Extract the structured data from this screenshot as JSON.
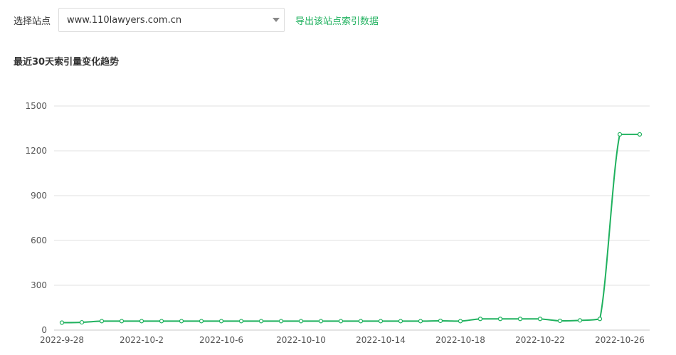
{
  "toolbar": {
    "site_label": "选择站点",
    "site_value": "www.110lawyers.com.cn",
    "export_label": "导出该站点索引数据"
  },
  "section_title": "最近30天索引量变化趋势",
  "colors": {
    "accent": "#1fb15e",
    "line": "#1fb15e",
    "grid": "#e0e0e0"
  },
  "icons": {
    "select_caret": "chevron-down-icon"
  },
  "chart_data": {
    "type": "line",
    "title": "",
    "xlabel": "",
    "ylabel": "",
    "ylim": [
      0,
      1500
    ],
    "y_ticks": [
      0,
      300,
      600,
      900,
      1200,
      1500
    ],
    "x_tick_labels": [
      "2022-9-28",
      "2022-10-2",
      "2022-10-6",
      "2022-10-10",
      "2022-10-14",
      "2022-10-18",
      "2022-10-22",
      "2022-10-26"
    ],
    "grid": true,
    "x": [
      "2022-9-28",
      "2022-9-29",
      "2022-9-30",
      "2022-10-1",
      "2022-10-2",
      "2022-10-3",
      "2022-10-4",
      "2022-10-5",
      "2022-10-6",
      "2022-10-7",
      "2022-10-8",
      "2022-10-9",
      "2022-10-10",
      "2022-10-11",
      "2022-10-12",
      "2022-10-13",
      "2022-10-14",
      "2022-10-15",
      "2022-10-16",
      "2022-10-17",
      "2022-10-18",
      "2022-10-19",
      "2022-10-20",
      "2022-10-21",
      "2022-10-22",
      "2022-10-23",
      "2022-10-24",
      "2022-10-25",
      "2022-10-26",
      "2022-10-27"
    ],
    "series": [
      {
        "values": [
          50,
          52,
          60,
          60,
          60,
          60,
          60,
          60,
          60,
          60,
          60,
          60,
          60,
          60,
          60,
          60,
          60,
          60,
          60,
          62,
          60,
          75,
          75,
          75,
          75,
          62,
          65,
          75,
          1310,
          1310
        ]
      }
    ]
  }
}
